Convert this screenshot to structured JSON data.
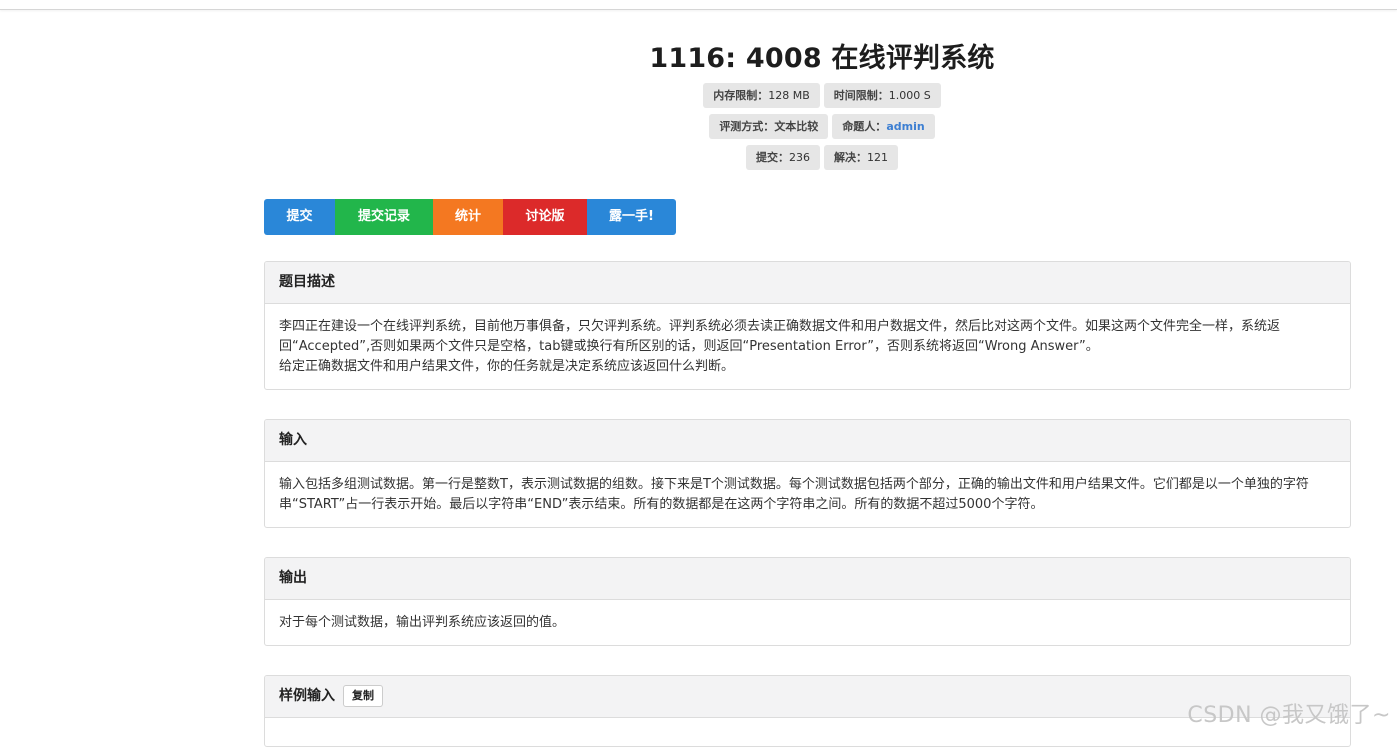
{
  "problem": {
    "title": "1116: 4008 在线评判系统",
    "memory": {
      "label": "内存限制：",
      "value": "128 MB"
    },
    "time": {
      "label": "时间限制：",
      "value": "1.000 S"
    },
    "judge": {
      "label": "评测方式：",
      "value": "文本比较"
    },
    "author": {
      "label": "命题人：",
      "value": "admin"
    },
    "submit": {
      "label": "提交：",
      "value": "236"
    },
    "solved": {
      "label": "解决：",
      "value": "121"
    }
  },
  "actions": [
    {
      "label": "提交",
      "color": "#2a87d8"
    },
    {
      "label": "提交记录",
      "color": "#22b64b"
    },
    {
      "label": "统计",
      "color": "#f47821"
    },
    {
      "label": "讨论版",
      "color": "#dc2a2a"
    },
    {
      "label": "露一手!",
      "color": "#2a87d8"
    }
  ],
  "sections": {
    "description": {
      "heading": "题目描述",
      "text1": "李四正在建设一个在线评判系统，目前他万事俱备，只欠评判系统。评判系统必须去读正确数据文件和用户数据文件，然后比对这两个文件。如果这两个文件完全一样，系统返回“Accepted”,否则如果两个文件只是空格，tab键或换行有所区别的话，则返回“Presentation Error”，否则系统将返回“Wrong Answer”。",
      "text2": "给定正确数据文件和用户结果文件，你的任务就是决定系统应该返回什么判断。"
    },
    "input": {
      "heading": "输入",
      "text": "输入包括多组测试数据。第一行是整数T，表示测试数据的组数。接下来是T个测试数据。每个测试数据包括两个部分，正确的输出文件和用户结果文件。它们都是以一个单独的字符串“START”占一行表示开始。最后以字符串“END”表示结束。所有的数据都是在这两个字符串之间。所有的数据不超过5000个字符。"
    },
    "output": {
      "heading": "输出",
      "text": "对于每个测试数据，输出评判系统应该返回的值。"
    },
    "sample_input": {
      "heading": "样例输入",
      "copy_label": "复制"
    }
  },
  "watermark": "CSDN @我又饿了~"
}
